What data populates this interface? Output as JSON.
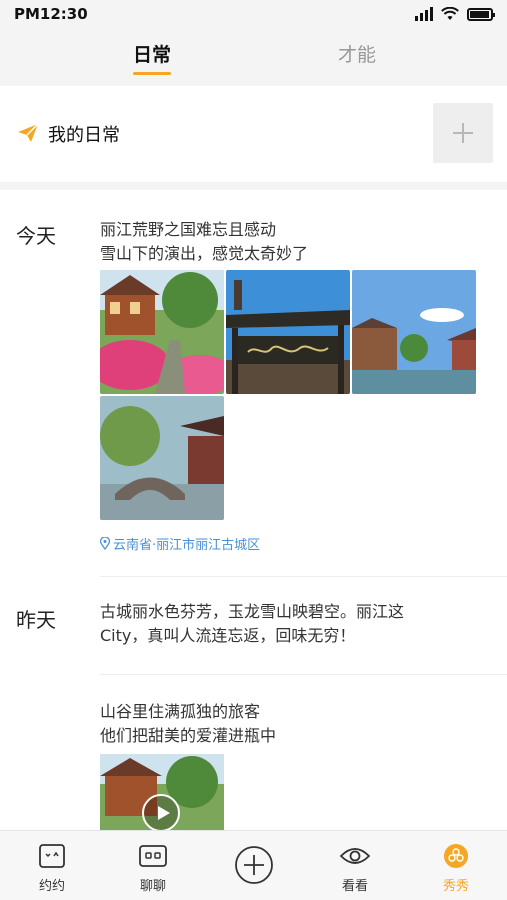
{
  "status_bar": {
    "time": "PM12:30"
  },
  "tabs": [
    {
      "label": "日常",
      "active": true
    },
    {
      "label": "才能",
      "active": false
    }
  ],
  "my_daily": {
    "label": "我的日常",
    "icon": "paper-plane-icon",
    "add_icon": "plus-icon"
  },
  "feed": {
    "today": {
      "day": "今天",
      "text_line1": "丽江荒野之国难忘且感动",
      "text_line2": "雪山下的演出，感觉太奇妙了",
      "photos": [
        "lijiang-flower-lane",
        "lijiang-old-town-gate",
        "lijiang-river-houses",
        "lijiang-stone-bridge"
      ],
      "location": "云南省·丽江市丽江古城区"
    },
    "yesterday": {
      "day": "昨天",
      "post1_line1": "古城丽水色芬芳，玉龙雪山映碧空。丽江这",
      "post1_line2": "City，真叫人流连忘返，回味无穷！",
      "post2_line1": "山谷里住满孤独的旅客",
      "post2_line2": "他们把甜美的爱灌进瓶中",
      "video": "lijiang-video-thumbnail"
    }
  },
  "bottom_nav": [
    {
      "label": "约约",
      "icon": "face-box-icon",
      "active": false
    },
    {
      "label": "聊聊",
      "icon": "robot-face-icon",
      "active": false
    },
    {
      "label": "",
      "icon": "plus-circle-icon",
      "active": false
    },
    {
      "label": "看看",
      "icon": "eye-icon",
      "active": false
    },
    {
      "label": "秀秀",
      "icon": "flower-icon",
      "active": true
    }
  ],
  "colors": {
    "accent": "#f5a623",
    "location": "#4a90d9"
  }
}
